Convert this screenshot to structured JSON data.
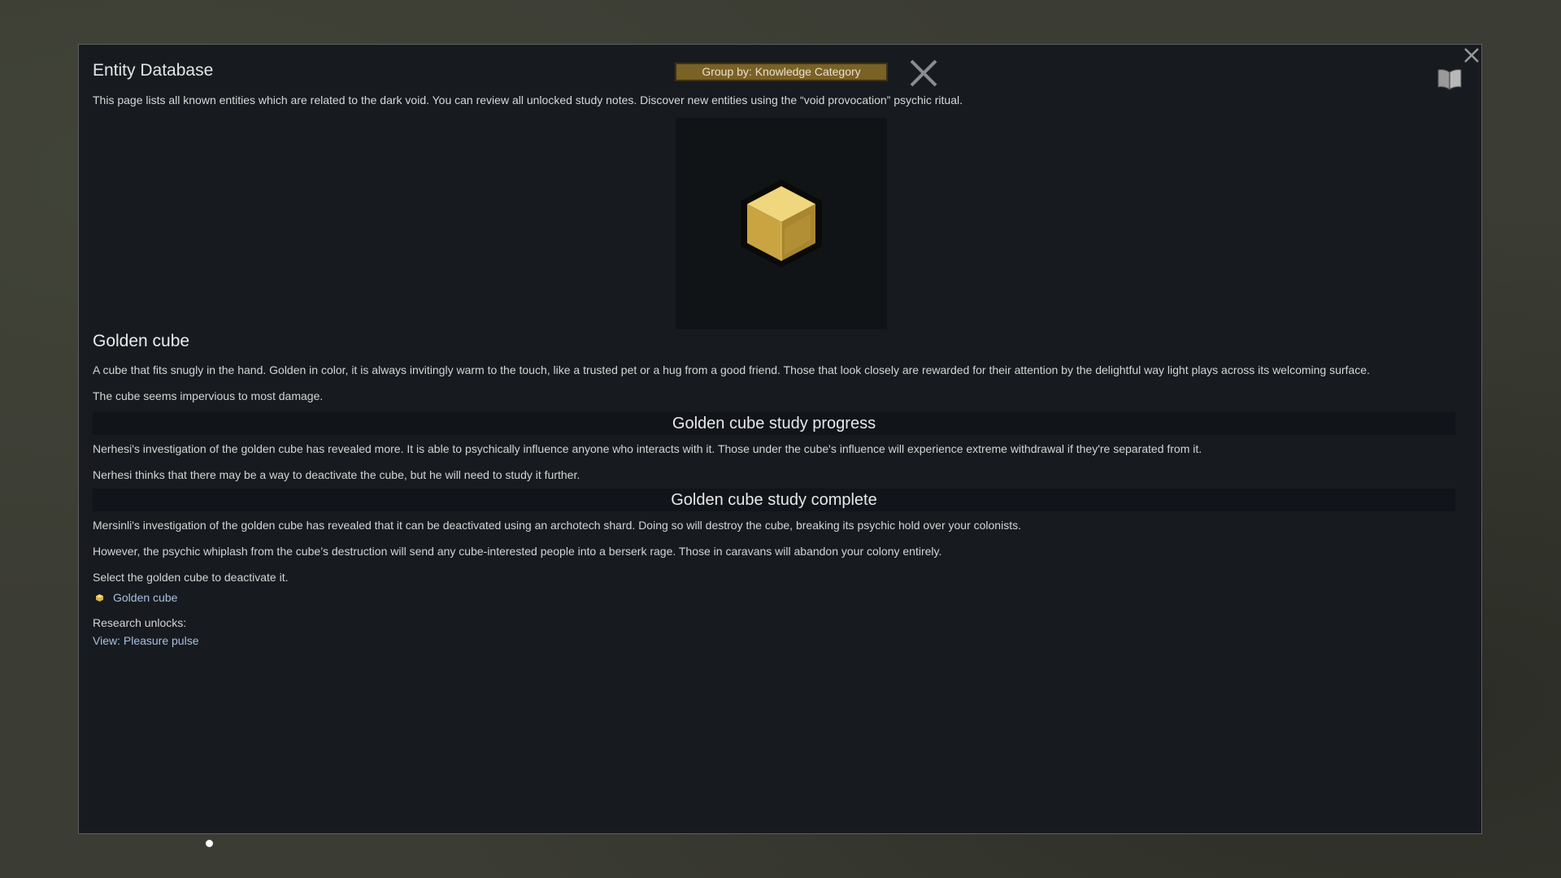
{
  "window": {
    "title": "Entity Database",
    "group_button_label": "Group by: Knowledge Category"
  },
  "intro_text": "This page lists all known entities which are related to the dark void. You can review all unlocked study notes. Discover new entities using the “void provocation” psychic ritual.",
  "entity": {
    "name": "Golden cube",
    "description": "A cube that fits snugly in the hand. Golden in color, it is always invitingly warm to the touch, like a trusted pet or a hug from a good friend. Those that look closely are rewarded for their attention by the delightful way light plays across its welcoming surface.",
    "note": "The cube seems impervious to most damage."
  },
  "sections": [
    {
      "heading": "Golden cube study progress",
      "paragraphs": [
        "Nerhesi's investigation of the golden cube has revealed more. It is able to psychically influence anyone who interacts with it. Those under the cube's influence will experience extreme withdrawal if they're separated from it.",
        "Nerhesi thinks that there may be a way to deactivate the cube, but he will need to study it further."
      ]
    },
    {
      "heading": "Golden cube study complete",
      "paragraphs": [
        "Mersinli's investigation of the golden cube has revealed that it can be deactivated using an archotech shard. Doing so will destroy the cube, breaking its psychic hold over your colonists.",
        "However, the psychic whiplash from the cube’s destruction will send any cube-interested people into a berserk rage. Those in caravans will abandon your colony entirely.",
        "Select the golden cube to deactivate it."
      ]
    }
  ],
  "linked_item": {
    "label": "Golden cube",
    "icon": "golden-cube-icon"
  },
  "research": {
    "label": "Research unlocks:",
    "link": "View: Pleasure pulse"
  },
  "colors": {
    "panel_bg": "#171b1f",
    "section_bg": "#11151a",
    "gold": "#d9b44f",
    "link": "#a6c0e0",
    "button_gold": "#7a6125"
  }
}
